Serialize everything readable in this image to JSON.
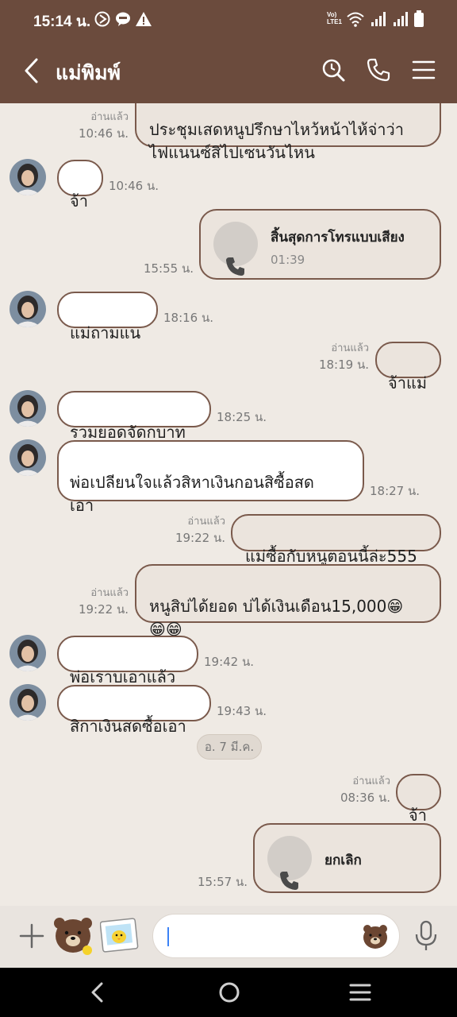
{
  "status_bar": {
    "time": "15:14 น.",
    "volte": "Vo)\nLTE1"
  },
  "header": {
    "contact_name": "แม่พิมพ์"
  },
  "messages": [
    {
      "direction": "out",
      "text": "ประชุมเสดหนูปรึกษาไหว้หน้าไห้จ่าว่า\nไฟแนนซ์สิไปเซนวันไหน",
      "read": "อ่านแล้ว",
      "time": "10:46 น."
    },
    {
      "direction": "in",
      "text": "จ้า",
      "time": "10:46 น."
    },
    {
      "direction": "out",
      "type": "call",
      "title": "สิ้นสุดการโทรแบบเสียง",
      "duration": "01:39",
      "time": "15:55 น."
    },
    {
      "direction": "in",
      "text": "แม่ถามแน",
      "time": "18:16 น."
    },
    {
      "direction": "out",
      "text": "จ้าแม่",
      "read": "อ่านแล้ว",
      "time": "18:19 น."
    },
    {
      "direction": "in",
      "text": "รวมยอดจัดกบาท",
      "time": "18:25 น."
    },
    {
      "direction": "in",
      "text": "พ่อเปลียนใจแล้วสิหาเงินกอนสิซื้อสด\nเอา",
      "time": "18:27 น."
    },
    {
      "direction": "out",
      "text": "แม่ซื้อกับหนูตอนนี้ล่ะ555",
      "read": "อ่านแล้ว",
      "time": "19:22 น."
    },
    {
      "direction": "out",
      "text": "หนูสิบ่ได้ยอด บ่ได้เงินเดือน15,000😁\n😁😁",
      "read": "อ่านแล้ว",
      "time": "19:22 น."
    },
    {
      "direction": "in",
      "text": "พ่อเราบเอาแล้ว",
      "time": "19:42 น."
    },
    {
      "direction": "in",
      "text": "สิกาเงินสดซื้อเอา",
      "time": "19:43 น."
    },
    {
      "direction": "out",
      "text": "จ้า",
      "read": "อ่านแล้ว",
      "time": "08:36 น."
    },
    {
      "direction": "out",
      "type": "call",
      "title": "ยกเลิก",
      "time": "15:57 น."
    }
  ],
  "date_divider": "อ. 7 มี.ค.",
  "colors": {
    "header_bg": "#6b4b3d",
    "chat_bg": "#efeae4",
    "bubble_border": "#7a5a4c",
    "outgoing_bubble": "#ebe4dd"
  },
  "icons": [
    "back-icon",
    "search-icon",
    "phone-icon",
    "menu-icon",
    "plus-icon",
    "sticker-icon",
    "gallery-icon",
    "emoji-bear-icon",
    "mic-icon"
  ]
}
